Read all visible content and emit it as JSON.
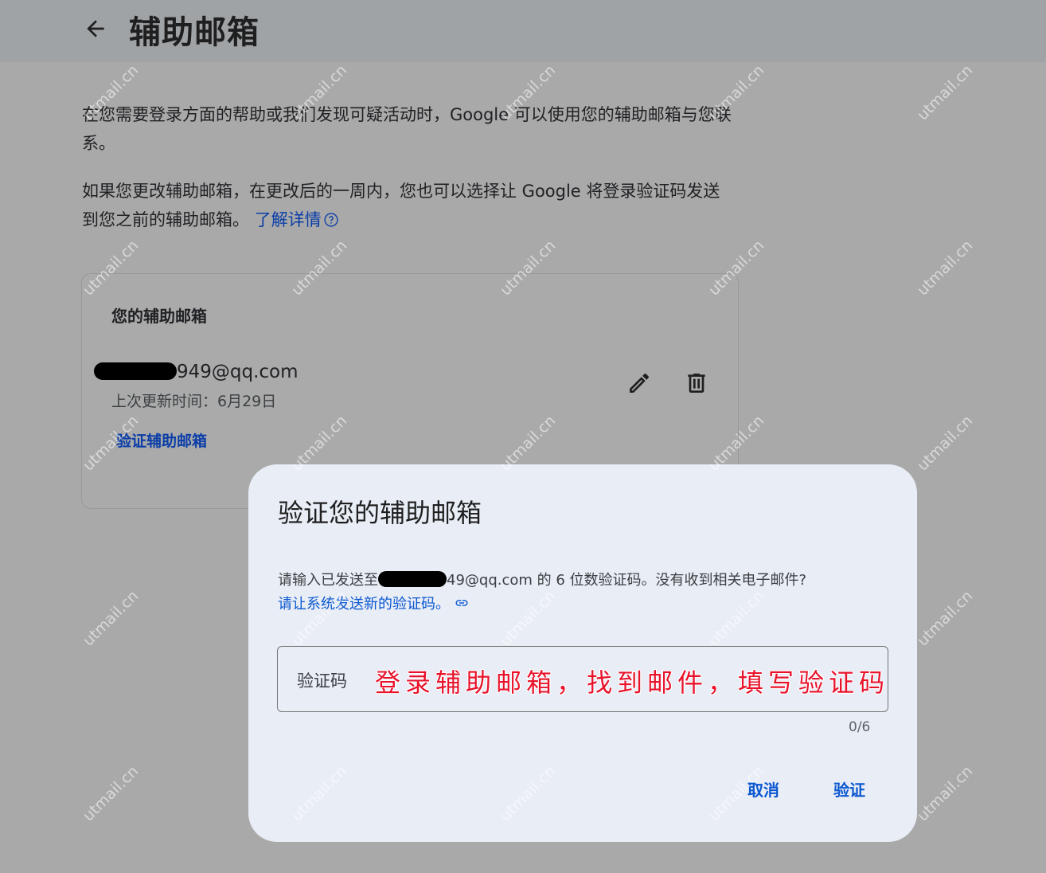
{
  "header": {
    "title": "辅助邮箱"
  },
  "intro": {
    "para1": "在您需要登录方面的帮助或我们发现可疑活动时，Google 可以使用您的辅助邮箱与您联系。",
    "para2": "如果您更改辅助邮箱，在更改后的一周内，您也可以选择让 Google 将登录验证码发送到您之前的辅助邮箱。",
    "learn_more": "了解详情"
  },
  "card": {
    "title": "您的辅助邮箱",
    "email_suffix": "949@qq.com",
    "updated": "上次更新时间：6月29日",
    "verify_link": "验证辅助邮箱"
  },
  "dialog": {
    "title": "验证您的辅助邮箱",
    "desc_prefix": "请输入已发送至",
    "desc_suffix": "49@qq.com 的 6 位数验证码。没有收到相关电子邮件?",
    "resend_link": "请让系统发送新的验证码。",
    "field_label": "验证码",
    "annotation": "登录辅助邮箱，找到邮件，填写验证码",
    "counter": "0/6",
    "cancel": "取消",
    "verify": "验证"
  },
  "watermark": "utmail.cn",
  "colors": {
    "link": "#0b57d0",
    "annotation": "#e8132b",
    "dialog_bg": "#e8edf6"
  }
}
